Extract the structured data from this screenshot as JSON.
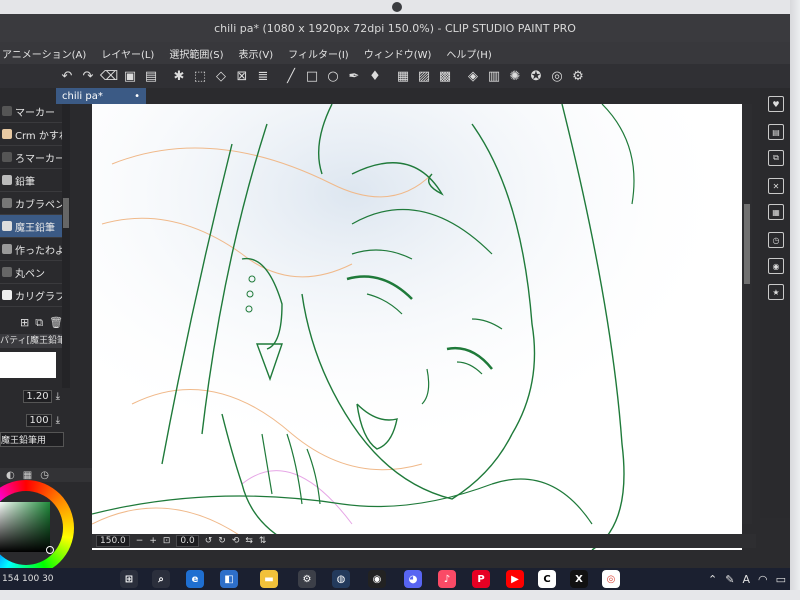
{
  "window": {
    "title": "chili pa* (1080 x 1920px 72dpi 150.0%) - CLIP STUDIO PAINT PRO"
  },
  "menubar": {
    "items": [
      "アニメーション(A)",
      "レイヤー(L)",
      "選択範囲(S)",
      "表示(V)",
      "フィルター(I)",
      "ウィンドウ(W)",
      "ヘルプ(H)"
    ]
  },
  "toolbar": {
    "icons": [
      "undo-icon",
      "redo-icon",
      "clear-icon",
      "fill-icon",
      "export-icon",
      "select-all-icon",
      "deselect-icon",
      "lasso-icon",
      "transform-icon",
      "layer-stack-icon",
      "line-icon",
      "rectangle-icon",
      "ellipse-icon",
      "eyedropper-icon",
      "fill-drop-icon",
      "grid-icon",
      "ruler-icon",
      "frame-icon",
      "snap-icon",
      "record-icon",
      "brush-size-icon",
      "clip-icon",
      "flip-icon"
    ]
  },
  "canvas": {
    "tab_label": "chili pa*",
    "tab_modified_marker": "•"
  },
  "tool_panel": {
    "brushes": [
      {
        "label": "マーカー"
      },
      {
        "label": "Crm かすれ"
      },
      {
        "label": "ろマーカー"
      },
      {
        "label": "鉛筆"
      },
      {
        "label": "カブラペン"
      },
      {
        "label": "魔王鉛筆"
      },
      {
        "label": "作ったわよ"
      },
      {
        "label": "丸ペン"
      },
      {
        "label": "カリグラフィ"
      }
    ],
    "selected_index": 5,
    "property_header": "パティ[魔王鉛筆]",
    "brush_size": "1.20",
    "opacity": "100",
    "material_label": "魔王鉛筆用"
  },
  "status": {
    "zoom": "150.0",
    "rotation": "0.0"
  },
  "taskbar": {
    "left_text": "154 100 30",
    "apps": [
      "windows",
      "search",
      "edge",
      "store",
      "explorer",
      "settings",
      "steam",
      "obs",
      "discord",
      "music",
      "pinterest",
      "youtube",
      "clip-studio",
      "x",
      "chrome"
    ]
  },
  "colors": {
    "sketch_green": "#1f7a3a",
    "rough_orange": "#f0b98a",
    "rough_magenta": "#e6a6e6",
    "selected_tab": "#3b5a85"
  }
}
